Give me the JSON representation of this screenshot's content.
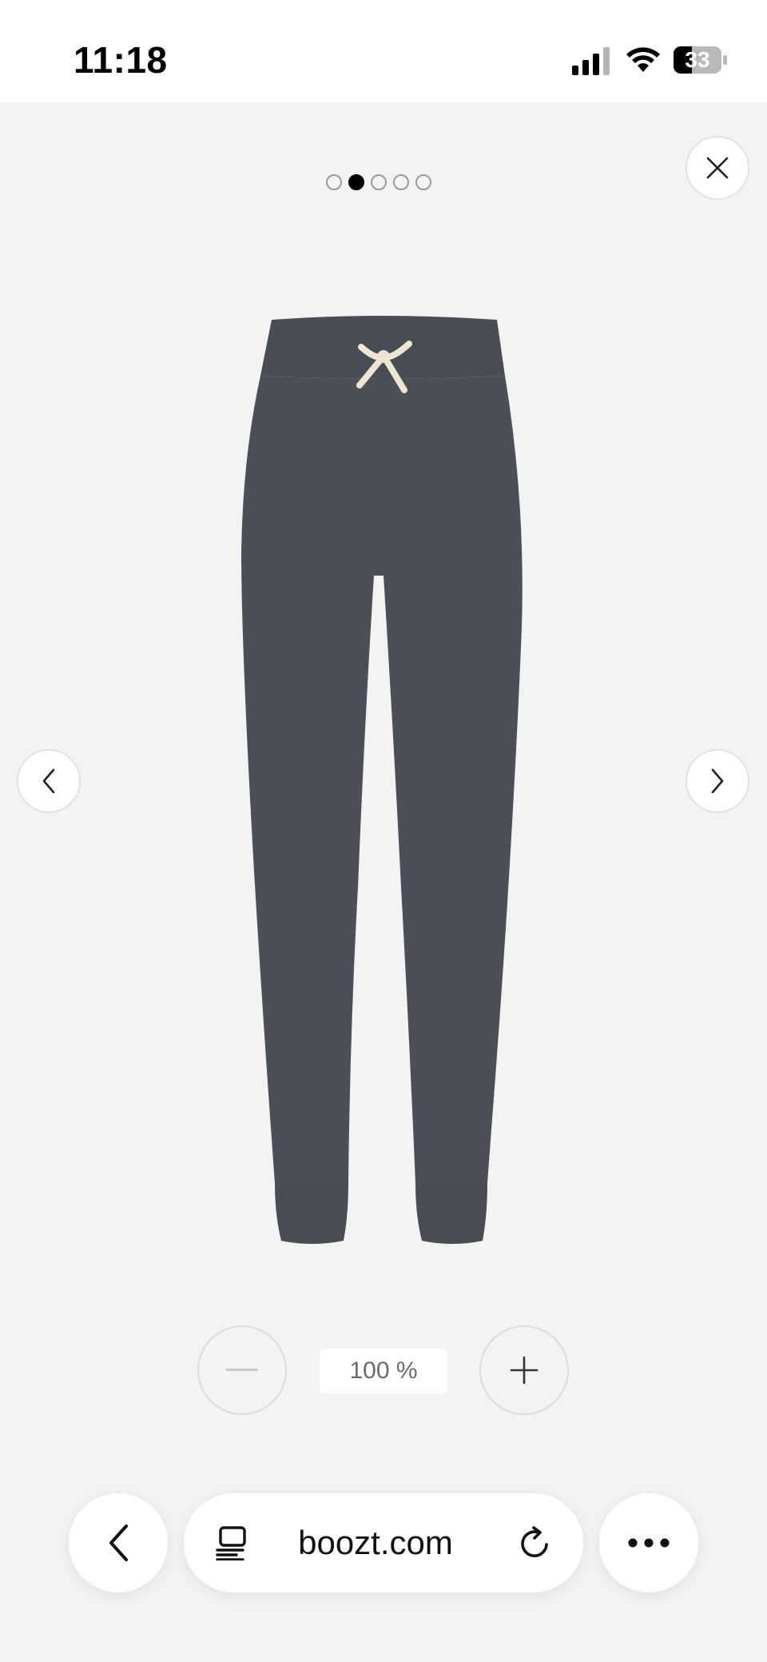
{
  "status_bar": {
    "time": "11:18",
    "battery": "33"
  },
  "gallery": {
    "image_count": 5,
    "active_index": 1,
    "product_image": "dark grey jogger sweatpants with drawstring",
    "product_color": "#4a4f58"
  },
  "zoom": {
    "level": "100 %"
  },
  "browser": {
    "url": "boozt.com"
  }
}
